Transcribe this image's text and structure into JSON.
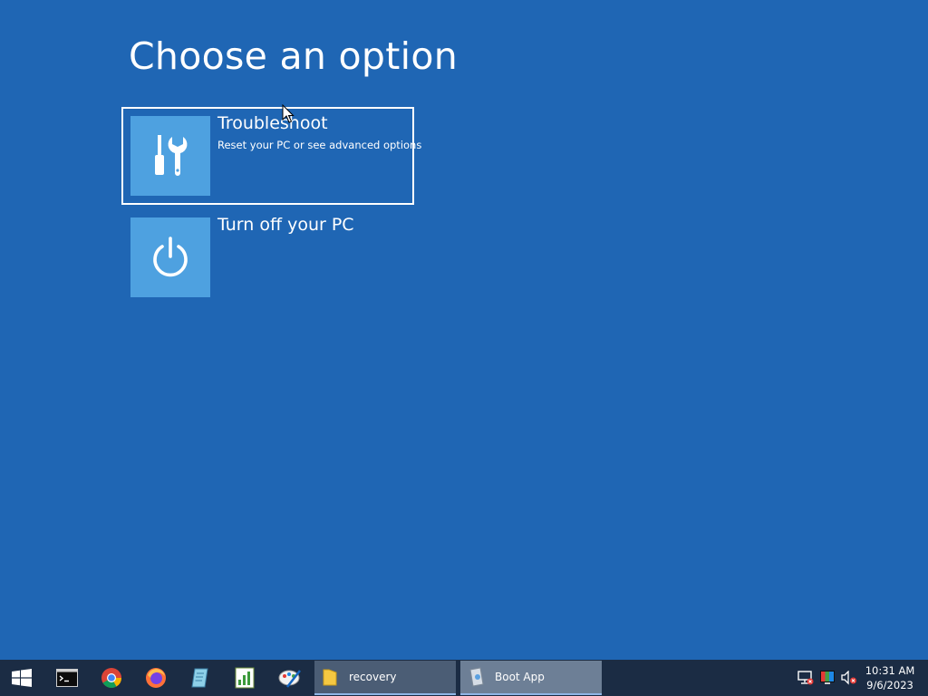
{
  "page": {
    "title": "Choose an option"
  },
  "options": [
    {
      "title": "Troubleshoot",
      "subtitle": "Reset your PC or see advanced options",
      "icon": "tools-icon",
      "selected": true
    },
    {
      "title": "Turn off your PC",
      "subtitle": "",
      "icon": "power-icon",
      "selected": false
    }
  ],
  "taskbar": {
    "pinned": [
      "start-icon",
      "command-prompt-icon",
      "chrome-icon",
      "firefox-icon",
      "notepad-icon",
      "spreadsheet-icon",
      "paint-icon"
    ],
    "tasks": [
      {
        "label": "recovery",
        "icon": "folder-icon"
      },
      {
        "label": "Boot App",
        "icon": "boot-app-icon",
        "active": true
      }
    ],
    "tray": {
      "time": "10:31 AM",
      "date": "9/6/2023"
    }
  },
  "colors": {
    "background": "#1f66b4",
    "tile": "#4ea1e0",
    "taskbar": "#1b2c44",
    "text": "#ffffff"
  }
}
